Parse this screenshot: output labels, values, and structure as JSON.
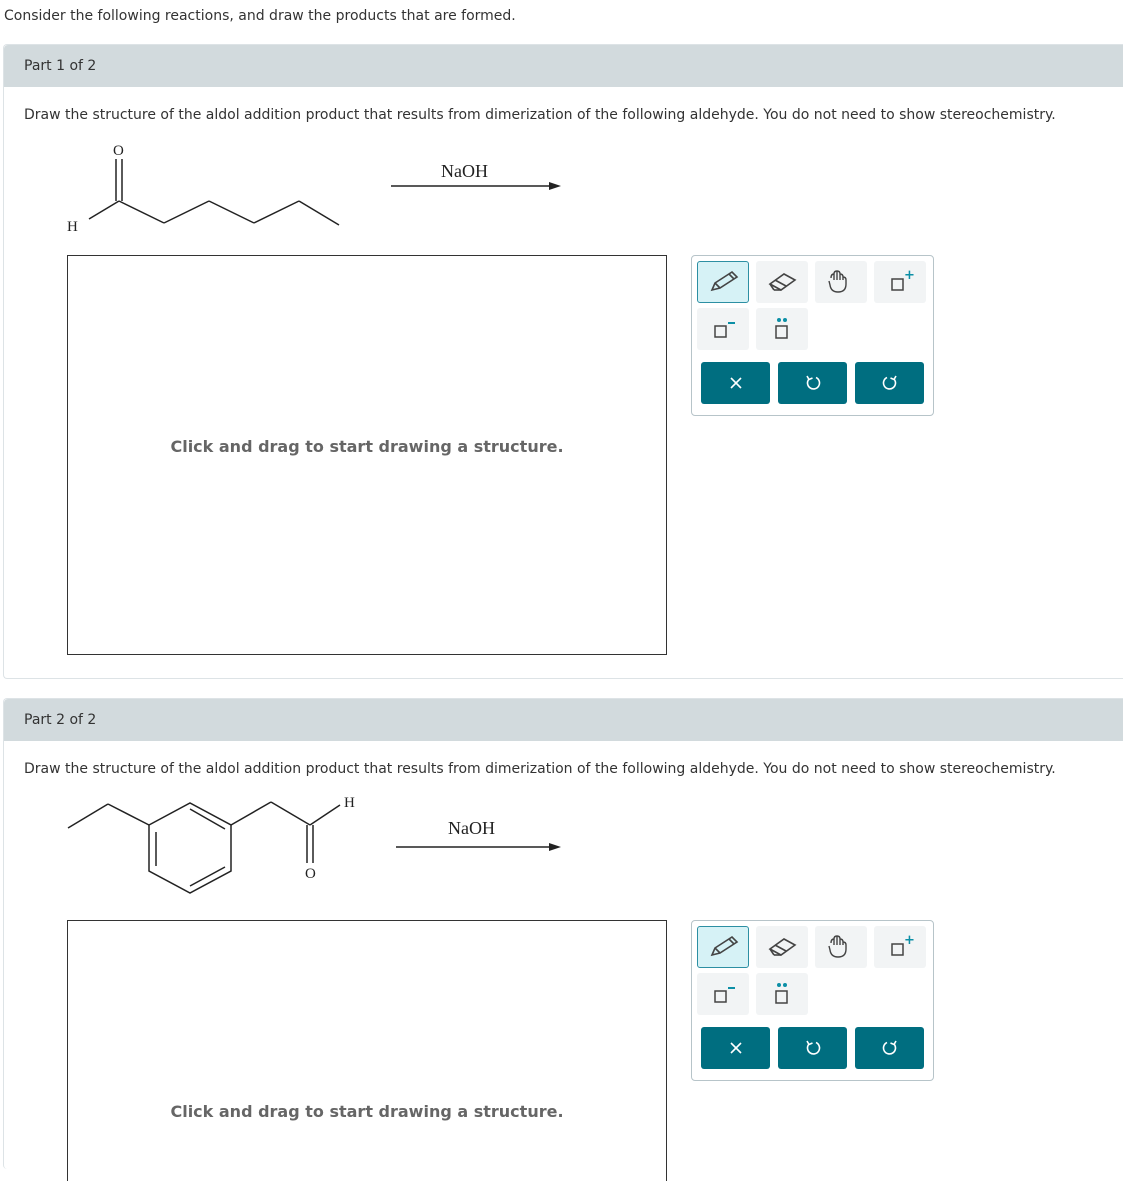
{
  "intro": "Consider the following reactions, and draw the products that are formed.",
  "parts": [
    {
      "header": "Part 1 of 2",
      "question": "Draw the structure of the aldol addition product that results from dimerization of the following aldehyde. You do not need to show stereochemistry.",
      "reagent": "NaOH",
      "atoms": {
        "o": "O",
        "h": "H"
      },
      "hint": "Click and drag to start drawing a structure."
    },
    {
      "header": "Part 2 of 2",
      "question": "Draw the structure of the aldol addition product that results from dimerization of the following aldehyde. You do not need to show stereochemistry.",
      "reagent": "NaOH",
      "atoms": {
        "o": "O",
        "h": "H"
      },
      "hint": "Click and drag to start drawing a structure."
    }
  ],
  "toolbar": {
    "tools": [
      "pencil-icon",
      "eraser-icon",
      "hand-icon",
      "positive-charge-icon",
      "negative-charge-icon",
      "lone-pair-icon"
    ],
    "actions": [
      "clear-icon",
      "undo-icon",
      "redo-icon"
    ],
    "accent": "#006e80",
    "active_bg": "#d6f2f6"
  }
}
